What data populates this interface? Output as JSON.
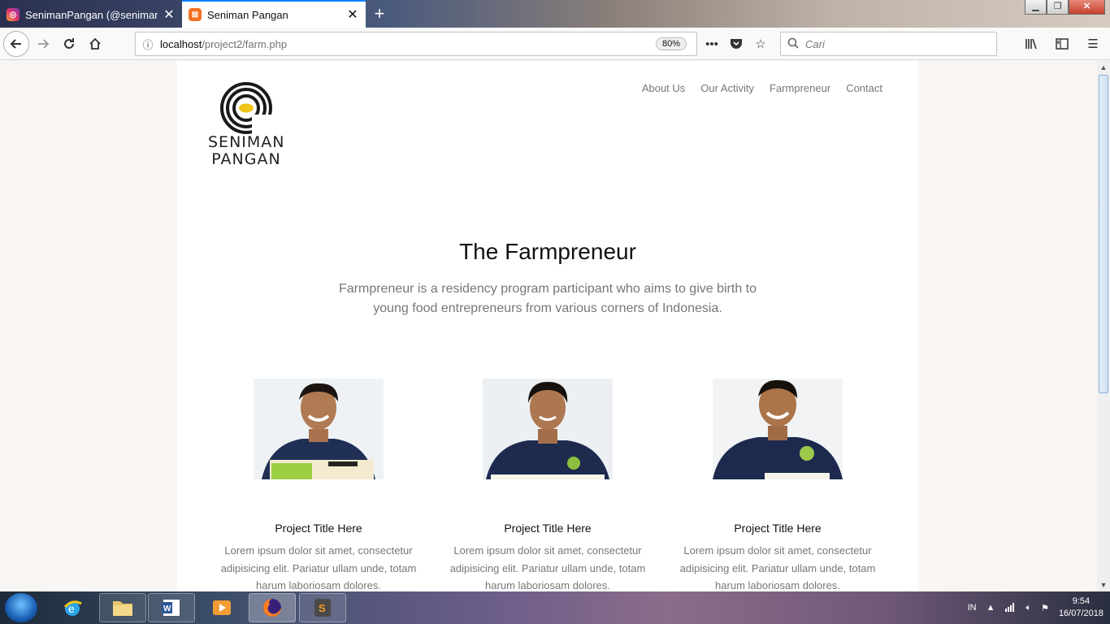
{
  "browser": {
    "tabs": [
      {
        "title": "SenimanPangan (@senimanpa",
        "icon": "instagram-icon",
        "active": false
      },
      {
        "title": "Seniman Pangan",
        "icon": "xampp-icon",
        "active": true
      }
    ],
    "url_host": "localhost",
    "url_path": "/project2/farm.php",
    "zoom": "80%",
    "search_placeholder": "Cari"
  },
  "site": {
    "logo_line1": "SENIMAN",
    "logo_line2": "PANGAN",
    "nav": [
      "About Us",
      "Our Activity",
      "Farmpreneur",
      "Contact"
    ],
    "heading": "The Farmpreneur",
    "intro": "Farmpreneur is a residency program participant who aims to give birth to young food entrepreneurs from various corners of Indonesia.",
    "cards": [
      {
        "title": "Project Title Here",
        "desc": "Lorem ipsum dolor sit amet, consectetur adipisicing elit. Pariatur ullam unde, totam harum laboriosam dolores."
      },
      {
        "title": "Project Title Here",
        "desc": "Lorem ipsum dolor sit amet, consectetur adipisicing elit. Pariatur ullam unde, totam harum laboriosam dolores."
      },
      {
        "title": "Project Title Here",
        "desc": "Lorem ipsum dolor sit amet, consectetur adipisicing elit. Pariatur ullam unde, totam harum laboriosam dolores."
      }
    ]
  },
  "taskbar": {
    "language": "IN",
    "time": "9:54",
    "date": "16/07/2018"
  },
  "colors": {
    "accent": "#0a84ff",
    "page_bg": "#f9f5f2",
    "text_muted": "#777777",
    "logo_yellow": "#f0c419"
  }
}
